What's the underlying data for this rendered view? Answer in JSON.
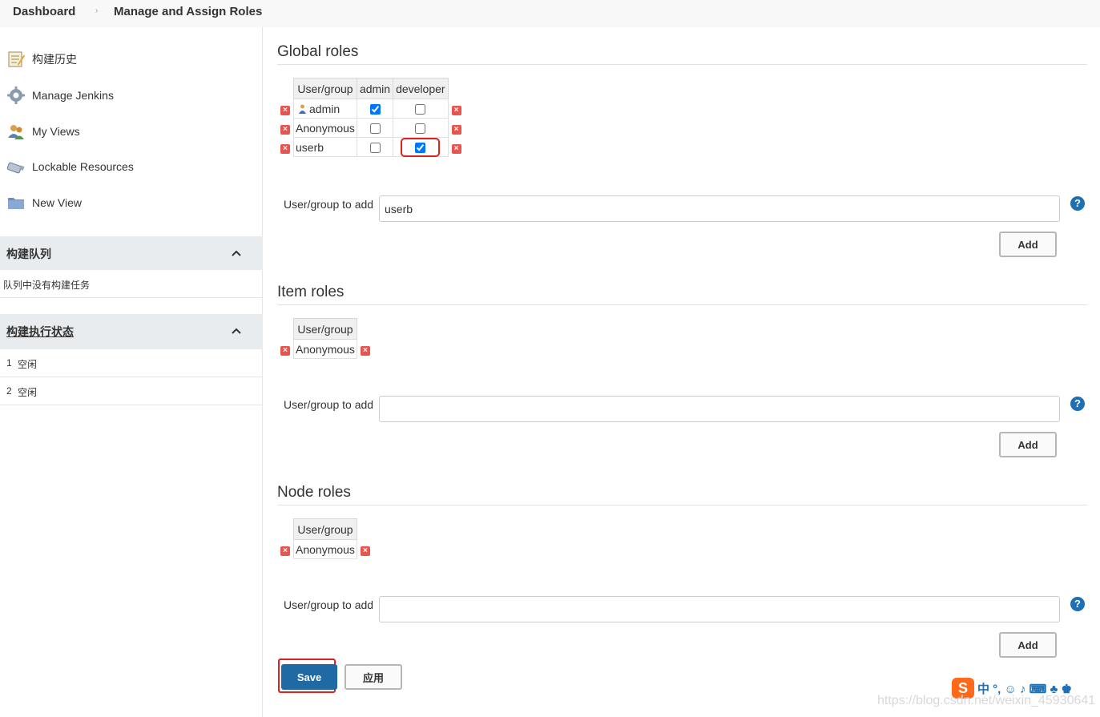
{
  "breadcrumb": {
    "home": "Dashboard",
    "separator": "›",
    "current": "Manage and Assign Roles"
  },
  "sidebar": {
    "items": [
      {
        "label": "构建历史",
        "icon": "notepad-icon"
      },
      {
        "label": "Manage Jenkins",
        "icon": "gear-icon"
      },
      {
        "label": "My Views",
        "icon": "users-icon"
      },
      {
        "label": "Lockable Resources",
        "icon": "usb-drive-icon"
      },
      {
        "label": "New View",
        "icon": "folder-icon"
      }
    ],
    "build_queue": {
      "title": "构建队列",
      "empty_text": "队列中没有构建任务"
    },
    "executors": {
      "title": "构建执行状态",
      "rows": [
        {
          "num": "1",
          "status": "空闲"
        },
        {
          "num": "2",
          "status": "空闲"
        }
      ]
    }
  },
  "global_roles": {
    "title": "Global roles",
    "header_user": "User/group",
    "columns": [
      "admin",
      "developer"
    ],
    "rows": [
      {
        "name": "admin",
        "admin": true,
        "developer": false
      },
      {
        "name": "Anonymous",
        "admin": false,
        "developer": false
      },
      {
        "name": "userb",
        "admin": false,
        "developer": true
      }
    ],
    "add_label": "User/group to add",
    "add_value": "userb",
    "add_button": "Add"
  },
  "item_roles": {
    "title": "Item roles",
    "header_user": "User/group",
    "rows": [
      {
        "name": "Anonymous"
      }
    ],
    "add_label": "User/group to add",
    "add_value": "",
    "add_button": "Add"
  },
  "node_roles": {
    "title": "Node roles",
    "header_user": "User/group",
    "rows": [
      {
        "name": "Anonymous"
      }
    ],
    "add_label": "User/group to add",
    "add_value": "",
    "add_button": "Add"
  },
  "help_glyph": "?",
  "delete_glyph": "×",
  "save_button": "Save",
  "apply_button": "应用",
  "watermark": "https://blog.csdn.net/weixin_45930641",
  "ime": {
    "logo": "S",
    "text": "中 °, ☺ ♪ ⌨ ♣ ♚"
  },
  "colors": {
    "primary": "#1f6aa5",
    "highlight": "#e02020",
    "delete": "#e8554e",
    "help": "#1e6fb3"
  }
}
